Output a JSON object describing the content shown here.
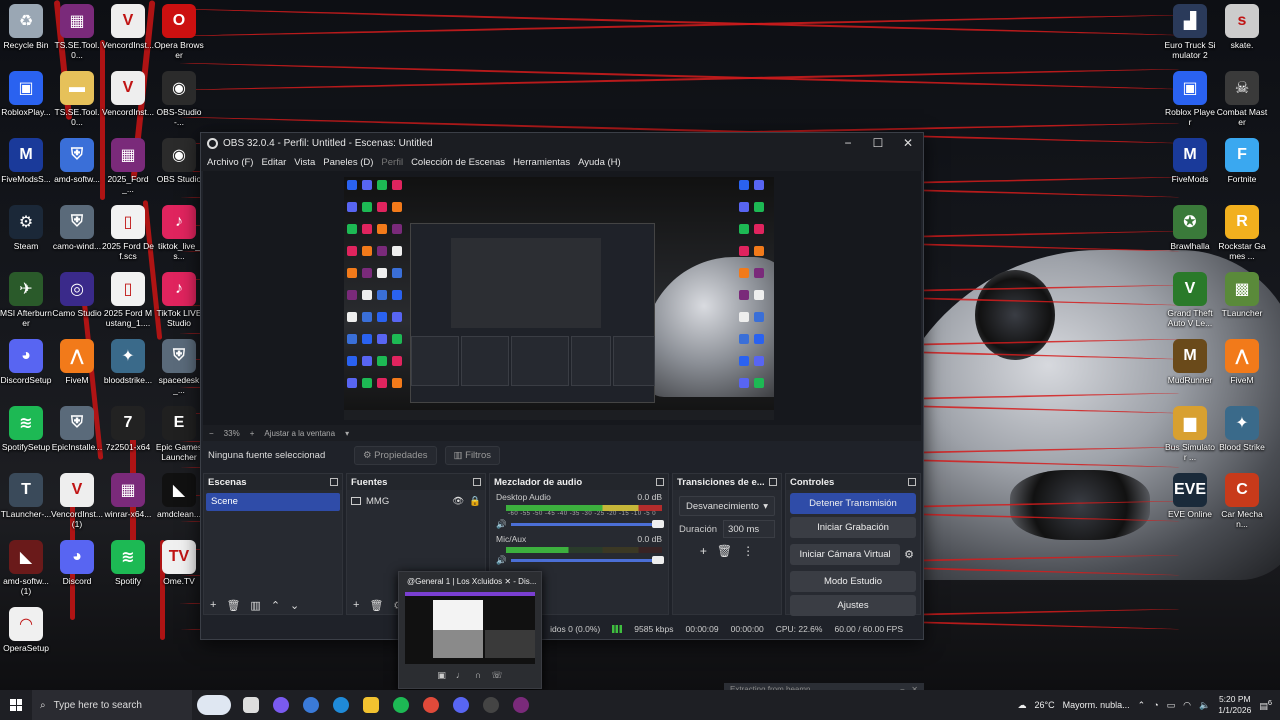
{
  "desktop_left": [
    {
      "label": "Recycle Bin",
      "icon": "recycle-bin-icon",
      "color": "#9aa7b4",
      "glyph": "♻"
    },
    {
      "label": "TS.SE.Tool.0...",
      "icon": "archive-icon",
      "color": "#7a2a7a",
      "glyph": "▦"
    },
    {
      "label": "VencordInst...",
      "icon": "vencord-icon",
      "color": "#eeeeee",
      "glyph": "V"
    },
    {
      "label": "Opera Browser",
      "icon": "opera-icon",
      "color": "#cc1010",
      "glyph": "O"
    },
    {
      "label": "RobloxPlay...",
      "icon": "roblox-icon",
      "color": "#2a62f0",
      "glyph": "▣"
    },
    {
      "label": "TS.SE.Tool.0...",
      "icon": "folder-icon",
      "color": "#e6c15a",
      "glyph": "▬"
    },
    {
      "label": "VencordInst...",
      "icon": "vencord-icon",
      "color": "#eeeeee",
      "glyph": "V"
    },
    {
      "label": "OBS-Studio-...",
      "icon": "obs-icon",
      "color": "#2b2b2b",
      "glyph": "◉"
    },
    {
      "label": "FiveModsS...",
      "icon": "fivemods-icon",
      "color": "#1a3a9a",
      "glyph": "M"
    },
    {
      "label": "amd-softw...",
      "icon": "shield-icon",
      "color": "#3a6fd8",
      "glyph": "⛨"
    },
    {
      "label": "2025_Ford_...",
      "icon": "archive-icon",
      "color": "#7a2a7a",
      "glyph": "▦"
    },
    {
      "label": "OBS Studio",
      "icon": "obs-icon",
      "color": "#2b2b2b",
      "glyph": "◉"
    },
    {
      "label": "Steam",
      "icon": "steam-icon",
      "color": "#1b2838",
      "glyph": "⚙"
    },
    {
      "label": "camo-wind...",
      "icon": "installer-icon",
      "color": "#5a6a7a",
      "glyph": "⛨"
    },
    {
      "label": "2025 Ford Def.scs",
      "icon": "file-icon",
      "color": "#f2f2f2",
      "glyph": "▯"
    },
    {
      "label": "tiktok_live_s...",
      "icon": "tiktok-icon",
      "color": "#e0245e",
      "glyph": "♪"
    },
    {
      "label": "MSI Afterburner",
      "icon": "msi-icon",
      "color": "#2a5a2a",
      "glyph": "✈"
    },
    {
      "label": "Camo Studio",
      "icon": "camo-icon",
      "color": "#3a2a8a",
      "glyph": "◎"
    },
    {
      "label": "2025 Ford Mustang_1....",
      "icon": "file-icon",
      "color": "#f2f2f2",
      "glyph": "▯"
    },
    {
      "label": "TikTok LIVE Studio",
      "icon": "tiktok-icon",
      "color": "#e0245e",
      "glyph": "♪"
    },
    {
      "label": "DiscordSetup",
      "icon": "discord-icon",
      "color": "#5865f2",
      "glyph": "◕"
    },
    {
      "label": "FiveM",
      "icon": "fivem-icon",
      "color": "#f27a1a",
      "glyph": "⋀"
    },
    {
      "label": "bloodstrike...",
      "icon": "bloodstrike-icon",
      "color": "#3a6a8a",
      "glyph": "✦"
    },
    {
      "label": "spacedesk_...",
      "icon": "installer-icon",
      "color": "#5a6a7a",
      "glyph": "⛨"
    },
    {
      "label": "SpotifySetup",
      "icon": "spotify-icon",
      "color": "#1db954",
      "glyph": "≋"
    },
    {
      "label": "EpicInstalle...",
      "icon": "installer-icon",
      "color": "#5a6a7a",
      "glyph": "⛨"
    },
    {
      "label": "7z2501-x64",
      "icon": "7zip-icon",
      "color": "#222222",
      "glyph": "7"
    },
    {
      "label": "Epic Games Launcher",
      "icon": "epic-icon",
      "color": "#202020",
      "glyph": "E"
    },
    {
      "label": "TLauncher-...",
      "icon": "tlauncher-icon",
      "color": "#3a4a5a",
      "glyph": "T"
    },
    {
      "label": "VencordInst... (1)",
      "icon": "vencord-icon",
      "color": "#eeeeee",
      "glyph": "V"
    },
    {
      "label": "winrar-x64...",
      "icon": "winrar-icon",
      "color": "#7a2a7a",
      "glyph": "▦"
    },
    {
      "label": "amdclean...",
      "icon": "amd-icon",
      "color": "#111111",
      "glyph": "◣"
    },
    {
      "label": "amd-softw... (1)",
      "icon": "amd-icon",
      "color": "#6a1a1a",
      "glyph": "◣"
    },
    {
      "label": "Discord",
      "icon": "discord-icon",
      "color": "#5865f2",
      "glyph": "◕"
    },
    {
      "label": "Spotify",
      "icon": "spotify-icon",
      "color": "#1db954",
      "glyph": "≋"
    },
    {
      "label": "Ome.TV",
      "icon": "ometv-icon",
      "color": "#f0f0f0",
      "glyph": "TV"
    },
    {
      "label": "OperaSetup",
      "icon": "opera-setup-icon",
      "color": "#f0f0f0",
      "glyph": "◠"
    }
  ],
  "desktop_right": [
    {
      "label": "Euro Truck Simulator 2",
      "icon": "ets2-icon",
      "color": "#2a3a5a",
      "glyph": "▟"
    },
    {
      "label": "skate.",
      "icon": "skate-icon",
      "color": "#cccccc",
      "glyph": "s"
    },
    {
      "label": "Roblox Player",
      "icon": "roblox-icon",
      "color": "#2a62f0",
      "glyph": "▣"
    },
    {
      "label": "Combat Master",
      "icon": "combat-icon",
      "color": "#3a3a3a",
      "glyph": "☠"
    },
    {
      "label": "FiveMods",
      "icon": "fivemods-icon",
      "color": "#1a3a9a",
      "glyph": "M"
    },
    {
      "label": "Fortnite",
      "icon": "fortnite-icon",
      "color": "#3aa8f0",
      "glyph": "F"
    },
    {
      "label": "Brawlhalla",
      "icon": "brawlhalla-icon",
      "color": "#3a7a3a",
      "glyph": "✪"
    },
    {
      "label": "Rockstar Games ...",
      "icon": "rockstar-icon",
      "color": "#f2b01e",
      "glyph": "R"
    },
    {
      "label": "Grand Theft Auto V Le...",
      "icon": "gta-icon",
      "color": "#2a7a2a",
      "glyph": "V"
    },
    {
      "label": "TLauncher",
      "icon": "minecraft-icon",
      "color": "#5a8a3a",
      "glyph": "▩"
    },
    {
      "label": "MudRunner",
      "icon": "mudrunner-icon",
      "color": "#6a4a1a",
      "glyph": "M"
    },
    {
      "label": "FiveM",
      "icon": "fivem-icon",
      "color": "#f27a1a",
      "glyph": "⋀"
    },
    {
      "label": "Bus Simulator ...",
      "icon": "bus-icon",
      "color": "#d8a030",
      "glyph": "▆"
    },
    {
      "label": "Blood Strike",
      "icon": "bloodstrike-icon",
      "color": "#3a6a8a",
      "glyph": "✦"
    },
    {
      "label": "EVE Online",
      "icon": "eve-icon",
      "color": "#1a2a3a",
      "glyph": "EVE"
    },
    {
      "label": "Car Mechan...",
      "icon": "car-mechanic-icon",
      "color": "#c83a1a",
      "glyph": "C"
    }
  ],
  "obs": {
    "title": "OBS 32.0.4 - Perfil: Untitled - Escenas: Untitled",
    "menu": [
      "Archivo (F)",
      "Editar",
      "Vista",
      "Paneles (D)",
      "Perfil",
      "Colección de Escenas",
      "Herramientas",
      "Ayuda (H)"
    ],
    "zoom": {
      "minus": "−",
      "value": "33%",
      "plus": "+",
      "fit": "Ajustar a la ventana",
      "caret": "▾"
    },
    "source_bar": {
      "no_selection": "Ninguna fuente seleccionad",
      "properties": "Propiedades",
      "filters": "Filtros"
    },
    "scenes": {
      "title": "Escenas",
      "items": [
        "Scene"
      ]
    },
    "sources": {
      "title": "Fuentes",
      "items": [
        "MMG"
      ]
    },
    "mixer": {
      "title": "Mezclador de audio",
      "tracks": [
        {
          "name": "Desktop Audio",
          "db": "0.0 dB",
          "level": 1.0
        },
        {
          "name": "Mic/Aux",
          "db": "0.0 dB",
          "level": 0.4
        }
      ],
      "ticks": "-60 -55 -50 -45 -40 -35 -30 -25 -20 -15 -10 -5 0"
    },
    "transitions": {
      "title": "Transiciones de e...",
      "selected": "Desvanecimiento",
      "duration_label": "Duración",
      "duration_value": "300 ms"
    },
    "controls": {
      "title": "Controles",
      "stop_stream": "Detener Transmisión",
      "start_record": "Iniciar Grabación",
      "virtual_cam": "Iniciar Cámara Virtual",
      "studio_mode": "Modo Estudio",
      "settings": "Ajustes"
    },
    "status": {
      "dropped": "idos 0 (0.0%)",
      "bitrate": "9585 kbps",
      "stream_time": "00:00:09",
      "rec_time": "00:00:00",
      "cpu": "CPU: 22.6%",
      "fps": "60.00 / 60.00 FPS"
    }
  },
  "discord_thumb": {
    "title": "@General 1 | Los Xcluidos ✕ - Dis..."
  },
  "notification": {
    "text": "Extracting from beamn...",
    "minimize": "−",
    "close": "✕"
  },
  "taskbar": {
    "search_placeholder": "Type here to search",
    "weather_temp": "26°C",
    "weather_desc": "Mayorm. nubla...",
    "time": "5:20 PM",
    "date": "1/1/2026",
    "notif_count": "6",
    "apps": [
      {
        "icon": "task-view-icon",
        "color": "#dddddd"
      },
      {
        "icon": "copilot-icon",
        "color": "#7a5af0"
      },
      {
        "icon": "store-icon",
        "color": "#3a7ad8"
      },
      {
        "icon": "edge-icon",
        "color": "#1f8ad8"
      },
      {
        "icon": "file-explorer-icon",
        "color": "#f2c230"
      },
      {
        "icon": "spotify-icon",
        "color": "#1db954"
      },
      {
        "icon": "chrome-icon",
        "color": "#e04a3a"
      },
      {
        "icon": "discord-icon",
        "color": "#5865f2"
      },
      {
        "icon": "obs-icon",
        "color": "#444444"
      },
      {
        "icon": "winrar-icon",
        "color": "#7a2a7a"
      }
    ]
  },
  "colors": {
    "accent": "#2f4ca8",
    "wallpaper_lines": "#d51c1c"
  }
}
